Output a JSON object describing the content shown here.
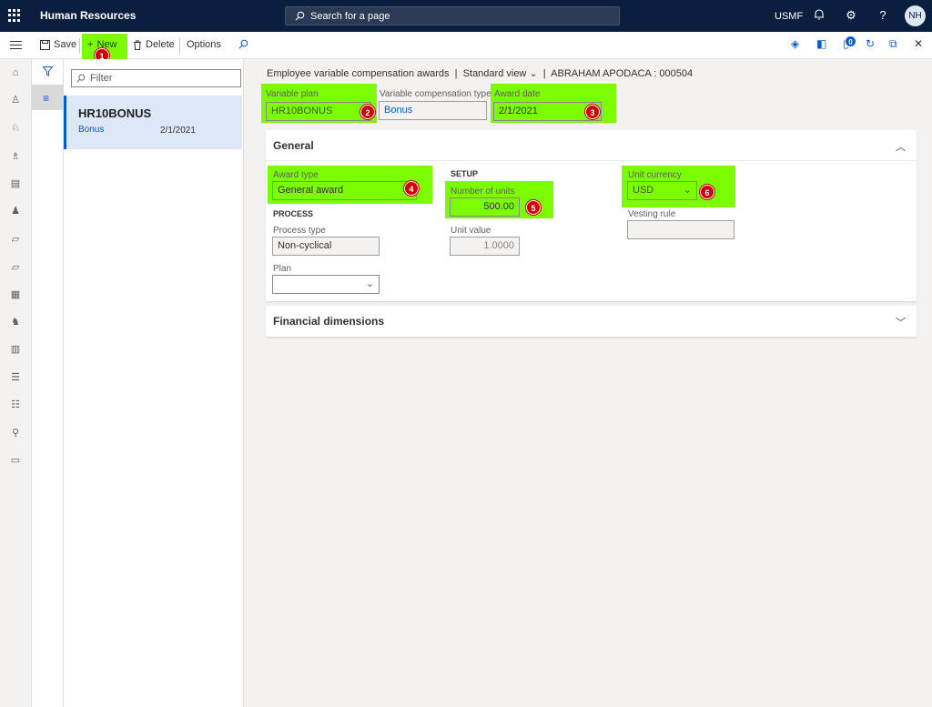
{
  "topbar": {
    "app_title": "Human Resources",
    "search_placeholder": "Search for a page",
    "company": "USMF",
    "avatar": "NH"
  },
  "actionbar": {
    "save": "Save",
    "new": "New",
    "delete": "Delete",
    "options": "Options",
    "notification_count": "0"
  },
  "callouts": [
    "1",
    "2",
    "3",
    "4",
    "5",
    "6"
  ],
  "listpane": {
    "filter_placeholder": "Filter",
    "items": [
      {
        "title": "HR10BONUS",
        "subtitle": "Bonus",
        "date": "2/1/2021"
      }
    ]
  },
  "breadcrumb": {
    "page": "Employee variable compensation awards",
    "view": "Standard view",
    "record": "ABRAHAM APODACA : 000504"
  },
  "header_fields": {
    "variable_plan": {
      "label": "Variable plan",
      "value": "HR10BONUS"
    },
    "comp_type": {
      "label": "Variable compensation type",
      "value": "Bonus"
    },
    "award_date": {
      "label": "Award date",
      "value": "2/1/2021"
    }
  },
  "general": {
    "title": "General",
    "award_type": {
      "label": "Award type",
      "value": "General award"
    },
    "process_heading": "PROCESS",
    "process_type": {
      "label": "Process type",
      "value": "Non-cyclical"
    },
    "plan": {
      "label": "Plan",
      "value": ""
    },
    "setup_heading": "SETUP",
    "number_of_units": {
      "label": "Number of units",
      "value": "500.00"
    },
    "unit_value": {
      "label": "Unit value",
      "value": "1.0000"
    },
    "unit_currency": {
      "label": "Unit currency",
      "value": "USD"
    },
    "vesting_rule": {
      "label": "Vesting rule",
      "value": ""
    }
  },
  "financial": {
    "title": "Financial dimensions"
  },
  "colors": {
    "topbar": "#0a1f3f",
    "accent": "#0a5cc5",
    "highlight": "#7cfc00",
    "callout": "#d00000"
  }
}
